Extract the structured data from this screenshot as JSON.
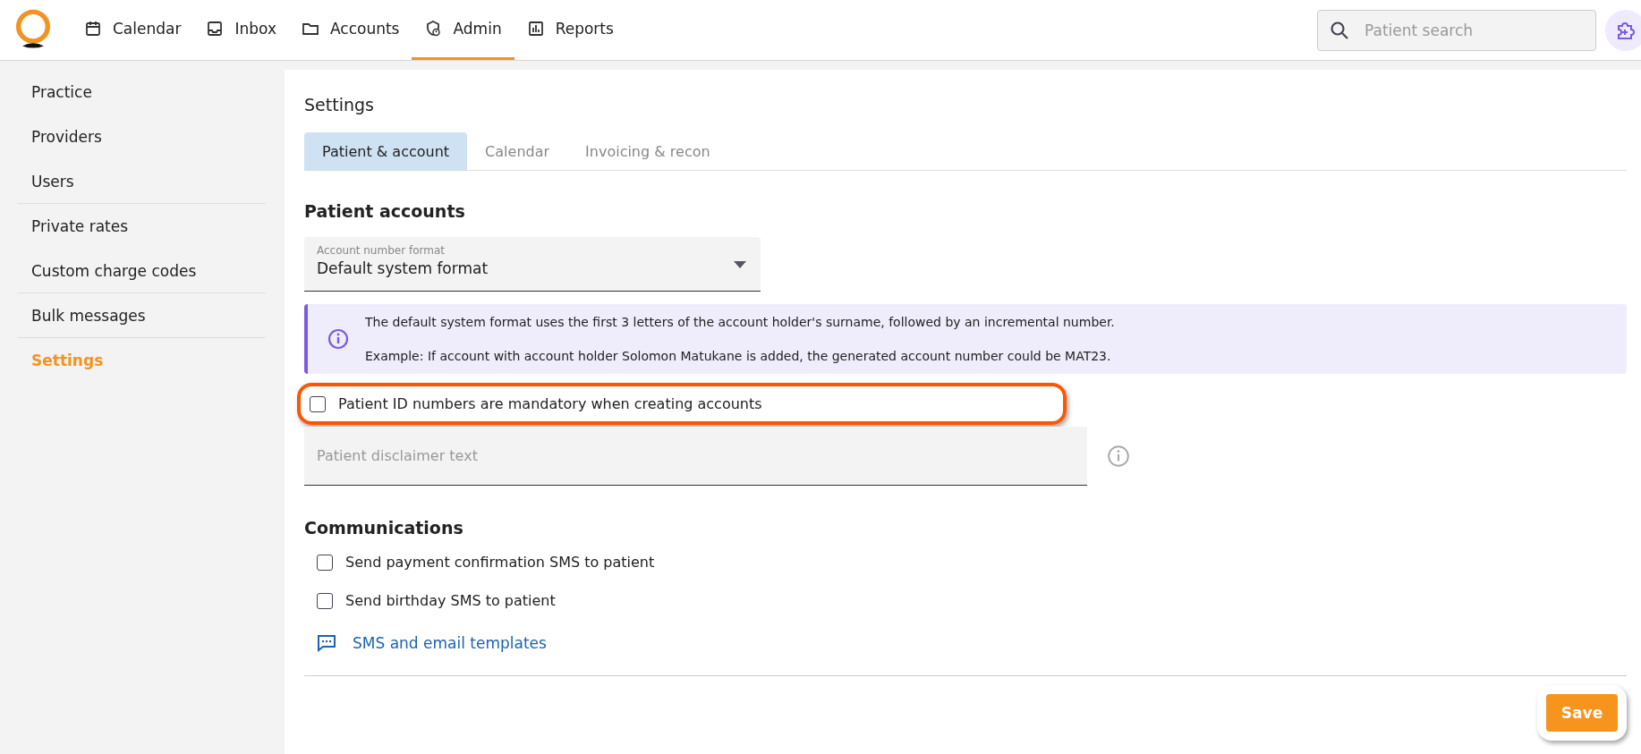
{
  "nav": {
    "items": [
      {
        "label": "Calendar",
        "kind": "calendar",
        "selected": false
      },
      {
        "label": "Inbox",
        "kind": "inbox",
        "selected": false
      },
      {
        "label": "Accounts",
        "kind": "folder",
        "selected": false
      },
      {
        "label": "Admin",
        "kind": "admin",
        "selected": true
      },
      {
        "label": "Reports",
        "kind": "chart",
        "selected": false
      }
    ],
    "search": {
      "placeholder": "Patient search"
    }
  },
  "sidebar": {
    "items": [
      {
        "label": "Practice",
        "selected": false,
        "divider": false
      },
      {
        "label": "Providers",
        "selected": false,
        "divider": false
      },
      {
        "label": "Users",
        "selected": false,
        "divider": true
      },
      {
        "label": "Private rates",
        "selected": false,
        "divider": false
      },
      {
        "label": "Custom charge codes",
        "selected": false,
        "divider": true
      },
      {
        "label": "Bulk messages",
        "selected": false,
        "divider": true
      },
      {
        "label": "Settings",
        "selected": true,
        "divider": false
      }
    ]
  },
  "page_title": "Settings",
  "tabs": [
    {
      "label": "Patient & account",
      "selected": true
    },
    {
      "label": "Calendar",
      "selected": false
    },
    {
      "label": "Invoicing & recon",
      "selected": false
    }
  ],
  "patient_accounts": {
    "heading": "Patient accounts",
    "account_format": {
      "label": "Account number format",
      "value": "Default system format"
    },
    "info": [
      "The default system format uses the first 3 letters of the account holder's surname, followed by an incremental number.",
      "Example: If account with account holder Solomon Matukane is added, the generated account number could be MAT23."
    ],
    "id_mandatory": {
      "label": "Patient ID numbers are mandatory when creating accounts",
      "checked": false,
      "highlighted": true
    },
    "disclaimer": {
      "placeholder": "Patient disclaimer text"
    }
  },
  "communications": {
    "heading": "Communications",
    "options": [
      {
        "label": "Send payment confirmation SMS to patient",
        "checked": false
      },
      {
        "label": "Send birthday SMS to patient",
        "checked": false
      }
    ],
    "link": "SMS and email templates"
  },
  "save": {
    "label": "Save",
    "highlighted": true
  }
}
